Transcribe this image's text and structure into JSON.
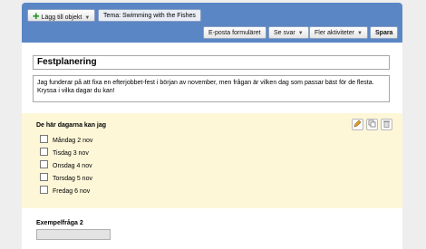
{
  "toolbar": {
    "add_item_label": "Lägg till objekt",
    "theme_label": "Tema:  Swimming with the Fishes",
    "email_form_label": "E-posta formuläret",
    "see_responses_label": "Se svar",
    "more_actions_label": "Fler aktiviteter",
    "save_label": "Spara"
  },
  "form": {
    "title": "Festplanering",
    "description": "Jag funderar på att fixa en efterjobbet-fest i början av november, men frågan är vilken dag som passar bäst för de flesta. Kryssa i vilka dagar du kan!"
  },
  "question1": {
    "title": "De här dagarna kan jag",
    "options": [
      "Måndag 2 nov",
      "Tisdag 3 nov",
      "Onsdag 4 nov",
      "Torsdag 5 nov",
      "Fredag 6 nov"
    ]
  },
  "question2": {
    "title": "Exempelfråga 2"
  },
  "colors": {
    "toolbar": "#5b86c5",
    "question_highlight": "#fdf7d8",
    "add_icon": "#2e9a2e"
  }
}
